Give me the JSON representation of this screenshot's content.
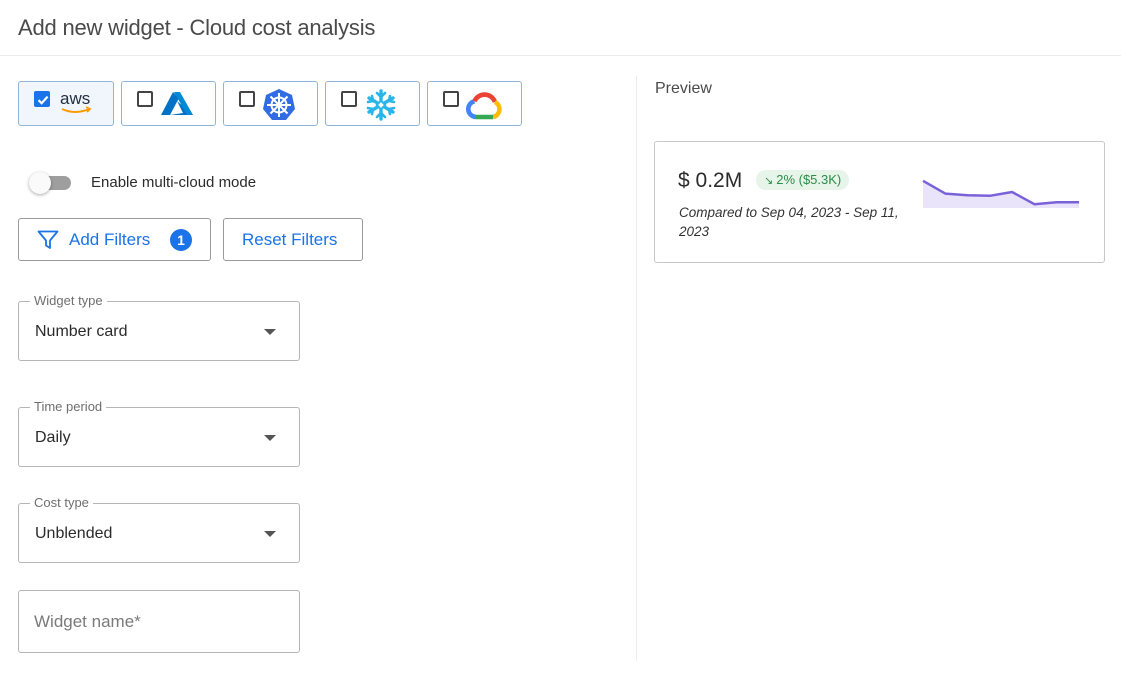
{
  "header": {
    "title": "Add new widget - Cloud cost analysis"
  },
  "providers": [
    {
      "name": "AWS",
      "checked": true,
      "icon": "aws-logo"
    },
    {
      "name": "Azure",
      "checked": false,
      "icon": "azure-logo"
    },
    {
      "name": "Kubernetes",
      "checked": false,
      "icon": "kubernetes-logo"
    },
    {
      "name": "Snowflake",
      "checked": false,
      "icon": "snowflake-logo"
    },
    {
      "name": "Google Cloud",
      "checked": false,
      "icon": "google-cloud-logo"
    }
  ],
  "aws_logo_text": "aws",
  "multicloud": {
    "label": "Enable multi-cloud mode",
    "enabled": false
  },
  "filters": {
    "add_label": "Add Filters",
    "count": "1",
    "reset_label": "Reset Filters",
    "icon": "filter-icon"
  },
  "widget_type": {
    "label": "Widget type",
    "value": "Number card"
  },
  "time_period": {
    "label": "Time period",
    "value": "Daily"
  },
  "cost_type": {
    "label": "Cost type",
    "value": "Unblended"
  },
  "widget_name": {
    "placeholder": "Widget name*",
    "value": ""
  },
  "preview": {
    "heading": "Preview",
    "value": "$ 0.2M",
    "delta": "2% ($5.3K)",
    "delta_icon": "trend-down-icon",
    "compare_text": "Compared to Sep 04, 2023 - Sep 11, 2023",
    "sparkline": [
      0.85,
      0.45,
      0.4,
      0.38,
      0.5,
      0.12,
      0.18,
      0.18
    ]
  },
  "colors": {
    "accent": "#1a73e8",
    "positive": "#2e8b47",
    "positive_bg": "#e6f4ea",
    "spark": "#7b61d9"
  }
}
